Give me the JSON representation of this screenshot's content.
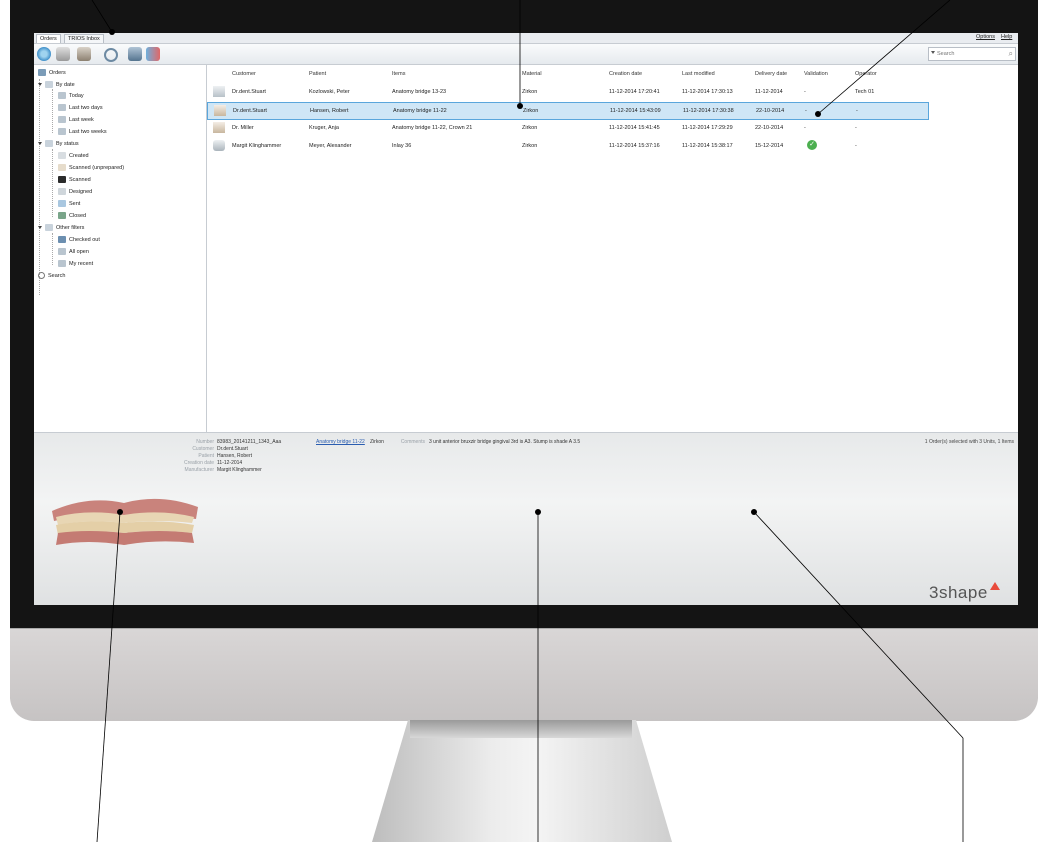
{
  "tabs": [
    {
      "label": "Orders"
    },
    {
      "label": "TRIOS Inbox"
    }
  ],
  "menu": {
    "options": "Options",
    "help": "Help"
  },
  "toolbar": {
    "icons": [
      "new-order-icon",
      "scan-icon",
      "design-icon",
      "settings-icon",
      "cut-icon",
      "send-icon"
    ],
    "search_placeholder": "Search"
  },
  "sidebar": {
    "root": "Orders",
    "by_date": {
      "label": "By date",
      "items": [
        "Today",
        "Last two days",
        "Last week",
        "Last two weeks"
      ]
    },
    "by_status": {
      "label": "By status",
      "items": [
        "Created",
        "Scanned (unprepared)",
        "Scanned",
        "Designed",
        "Sent",
        "Closed"
      ]
    },
    "other_filters": {
      "label": "Other filters",
      "items": [
        "Checked out",
        "All open",
        "My recent"
      ]
    },
    "search": "Search"
  },
  "grid": {
    "columns": [
      "Customer",
      "Patient",
      "Items",
      "Material",
      "Creation date",
      "Last modified",
      "Delivery date",
      "Validation",
      "Operator"
    ],
    "rows": [
      {
        "customer": "Dr.dent.Stuart",
        "patient": "Kozlowski, Peter",
        "items": "Anatomy bridge 13-23",
        "material": "Zirkon",
        "created": "11-12-2014 17:20:41",
        "modified": "11-12-2014 17:30:13",
        "delivery": "11-12-2014",
        "validation": "-",
        "operator": "Tech 01"
      },
      {
        "customer": "Dr.dent.Stuart",
        "patient": "Hansen, Robert",
        "items": "Anatomy bridge 11-22",
        "material": "Zirkon",
        "created": "11-12-2014 15:43:09",
        "modified": "11-12-2014 17:30:38",
        "delivery": "22-10-2014",
        "validation": "-",
        "operator": "-"
      },
      {
        "customer": "Dr. Miller",
        "patient": "Kruger, Anja",
        "items": "Anatomy bridge 11-22, Crown 21",
        "material": "Zirkon",
        "created": "11-12-2014 15:41:45",
        "modified": "11-12-2014 17:29:29",
        "delivery": "22-10-2014",
        "validation": "-",
        "operator": "-"
      },
      {
        "customer": "Margit Klinghammer",
        "patient": "Meyer, Alexander",
        "items": "Inlay 36",
        "material": "Zirkon",
        "created": "11-12-2014 15:37:16",
        "modified": "11-12-2014 15:38:17",
        "delivery": "15-12-2014",
        "validation": "",
        "operator": "-"
      }
    ]
  },
  "details": {
    "labels": {
      "number": "Number",
      "customer": "Customer",
      "patient": "Patient",
      "creation_date": "Creation date",
      "manufacturer": "Manufacturer",
      "comments": "Comments"
    },
    "number": "83983_20141211_1343_Aaa",
    "customer": "Dr.dent.Stuart",
    "patient": "Hansen, Robert",
    "creation_date": "11-12-2014",
    "manufacturer": "Margit Klinghammer",
    "item_link": "Anatomy bridge 11-22",
    "material": "Zirkon",
    "comments": "3 unit anterior bruxzir bridge gingival 3rd is A3. Stump is shade A 3.5",
    "selection_status": "1 Order(s) selected with 3 Units, 1 Items"
  },
  "brand": "3shape",
  "colors": {
    "selection": "#cfe6f6",
    "selection_border": "#5aa6dc",
    "brand_accent": "#e84b3c",
    "validation_ok": "#4caf50"
  }
}
